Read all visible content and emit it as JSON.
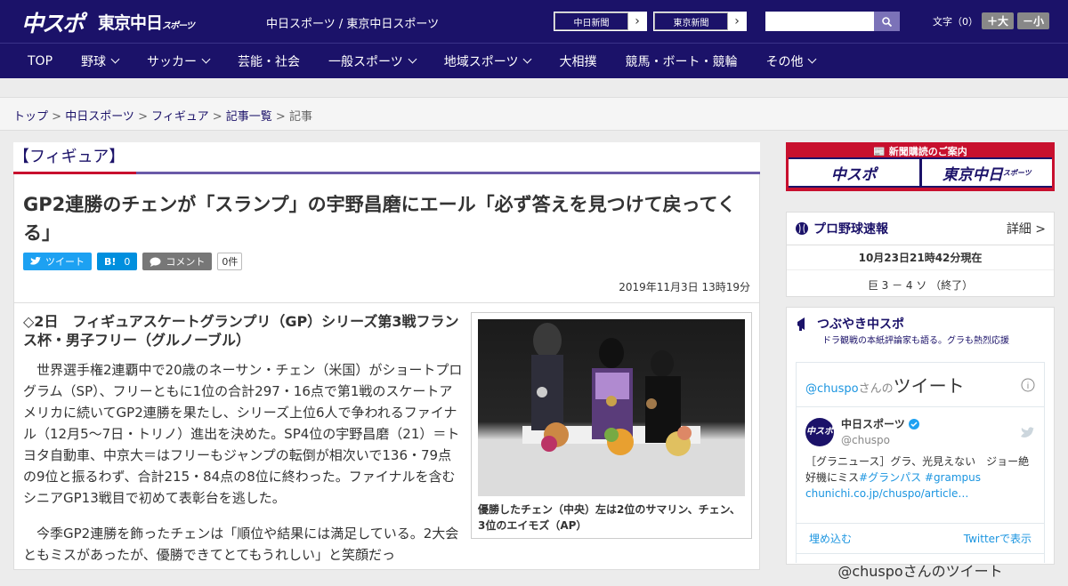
{
  "header": {
    "logo1": "中スポ",
    "logo2": "東京中日",
    "logo2_small": "スポーツ",
    "sitename": "中日スポーツ / 東京中日スポーツ",
    "paper1": "中日新聞",
    "paper2": "東京新聞",
    "font_label": "文字（0）",
    "font_big": "＋大",
    "font_small": "－小"
  },
  "nav": [
    "TOP",
    "野球",
    "サッカー",
    "芸能・社会",
    "一般スポーツ",
    "地域スポーツ",
    "大相撲",
    "競馬・ボート・競輪",
    "その他"
  ],
  "breadcrumb": {
    "items": [
      "トップ",
      "中日スポーツ",
      "フィギュア",
      "記事一覧"
    ],
    "current": "記事"
  },
  "article": {
    "category": "【フィギュア】",
    "title": "GP2連勝のチェンが「スランプ」の宇野昌磨にエール「必ず答えを見つけて戻ってくる」",
    "tweet_label": "ツイート",
    "hatena_label": "B!",
    "hatena_count": "0",
    "comment_label": "コメント",
    "comment_count": "0件",
    "date": "2019年11月3日 13時19分",
    "subtitle": "◇2日　フィギュアスケートグランプリ（GP）シリーズ第3戦フランス杯・男子フリー（グルノーブル）",
    "p1": "世界選手権2連覇中で20歳のネーサン・チェン（米国）がショートプログラム（SP）、フリーともに1位の合計297・16点で第1戦のスケートアメリカに続いてGP2連勝を果たし、シリーズ上位6人で争われるファイナル（12月5～7日・トリノ）進出を決めた。SP4位の宇野昌磨（21）＝トヨタ自動車、中京大＝はフリーもジャンプの転倒が相次いで136・79点の9位と振るわず、合計215・84点の8位に終わった。ファイナルを含むシニアGP13戦目で初めて表彰台を逃した。",
    "p2": "今季GP2連勝を飾ったチェンは「順位や結果には満足している。2大会ともミスがあったが、優勝できてとてもうれしい」と笑顔だっ",
    "caption": "優勝したチェン（中央）左は2位のサマリン、チェン、3位のエイモズ（AP）"
  },
  "side": {
    "ad_title": "新聞購読のご案内",
    "ad_b1": "中スポ",
    "ad_b2": "東京中日",
    "ad_b2_small": "スポーツ",
    "bb_title": "プロ野球速報",
    "bb_detail": "詳細 >",
    "bb_time": "10月23日21時42分現在",
    "bb_score": "巨 3 － 4 ソ （終了）",
    "tw_title": "つぶやき中スポ",
    "tw_sub": "ドラ観戦の本紙評論家も語る。グラも熱烈応援",
    "tl_user": "@chuspo",
    "tl_user_suffix": "さんの",
    "tl_label": "ツイート",
    "tweet_name": "中日スポーツ",
    "tweet_handle": "@chuspo",
    "tweet_text": "［グラニュース］グラ、光見えない　ジョー絶好機にミス",
    "tweet_tags": "#グランパス #grampus",
    "tweet_link": "chunichi.co.jp/chuspo/article…",
    "embed": "埋め込む",
    "view_on": "Twitterで表示",
    "footer_text": "@chuspoさんのツイート",
    "av_text": "中スポ"
  }
}
